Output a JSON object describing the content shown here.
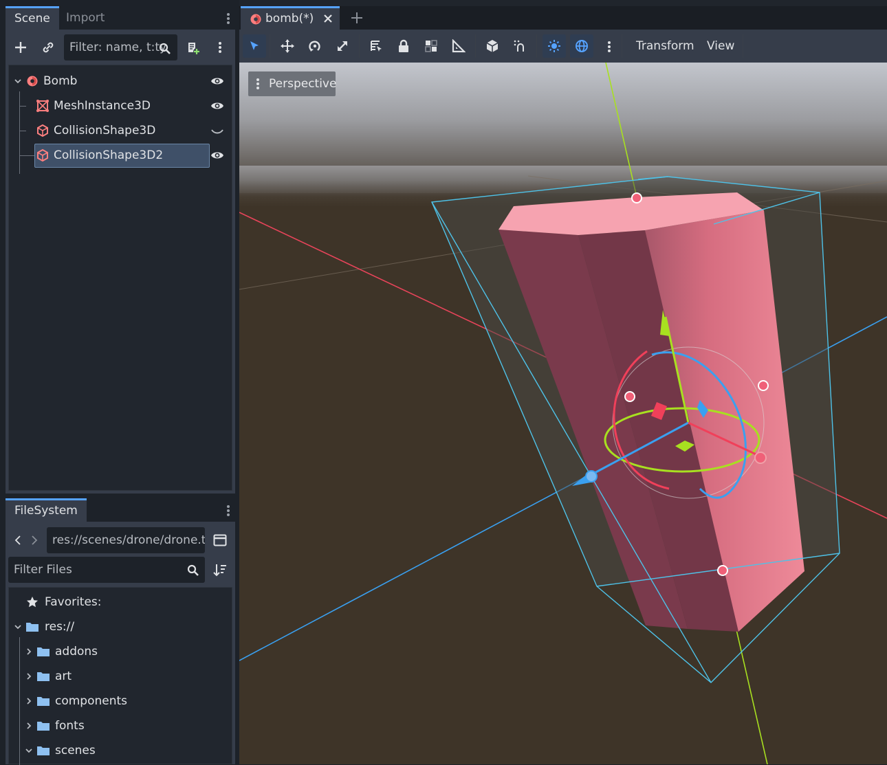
{
  "scene_dock": {
    "tabs": [
      {
        "label": "Scene"
      },
      {
        "label": "Import"
      }
    ],
    "filter_placeholder": "Filter: name, t:ty",
    "tree": [
      {
        "label": "Bomb",
        "icon": "node3d-icon"
      },
      {
        "label": "MeshInstance3D",
        "icon": "mesh-instance-icon"
      },
      {
        "label": "CollisionShape3D",
        "icon": "collision-shape-icon"
      },
      {
        "label": "CollisionShape3D2",
        "icon": "collision-shape-icon",
        "selected": true
      }
    ]
  },
  "filesystem_dock": {
    "tab": "FileSystem",
    "path": "res://scenes/drone/drone.t",
    "filter_placeholder": "Filter Files",
    "favorites_label": "Favorites:",
    "root_label": "res://",
    "folders": [
      {
        "label": "addons"
      },
      {
        "label": "art"
      },
      {
        "label": "components"
      },
      {
        "label": "fonts"
      },
      {
        "label": "scenes"
      }
    ]
  },
  "editor": {
    "scene_tab": "bomb(*)",
    "menus": {
      "transform": "Transform",
      "view": "View"
    },
    "viewport_label": "Perspective"
  },
  "colors": {
    "accent": "#56a3ff",
    "x_axis": "#f0405a",
    "y_axis": "#a8e020",
    "z_axis": "#3aa0f0",
    "mesh": "#f6a3b0",
    "ground": "#3e3428"
  }
}
